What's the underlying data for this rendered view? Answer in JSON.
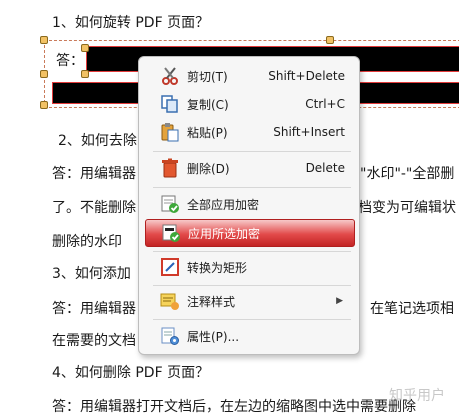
{
  "document": {
    "heading1": "1、如何旋转 PDF 页面？",
    "answer_label": "答：",
    "heading2": "2、如何去除",
    "line_a": "答：用编辑器",
    "line_a_right": "\"水印\"-\"全部删",
    "line_b": "了。不能删除",
    "line_b_right": "档变为可编辑状",
    "line_c": "删除的水印",
    "heading3": "3、如何添加",
    "line_d": "答：用编辑器",
    "line_d_right": "在笔记选项相",
    "line_e": "在需要的文档",
    "heading4": "4、如何删除 PDF 页面？",
    "line_f": "答：用编辑器打开文档后，在左边的缩略图中选中需要删除"
  },
  "context_menu": {
    "items": [
      {
        "label": "剪切(T)",
        "shortcut": "Shift+Delete",
        "icon": "scissors-icon"
      },
      {
        "label": "复制(C)",
        "shortcut": "Ctrl+C",
        "icon": "copy-icon"
      },
      {
        "label": "粘贴(P)",
        "shortcut": "Shift+Insert",
        "icon": "paste-icon"
      },
      {
        "label": "删除(D)",
        "shortcut": "Delete",
        "icon": "trash-icon"
      },
      {
        "label": "全部应用加密",
        "shortcut": "",
        "icon": "apply-all-redaction-icon"
      },
      {
        "label": "应用所选加密",
        "shortcut": "",
        "icon": "apply-selected-redaction-icon"
      },
      {
        "label": "转换为矩形",
        "shortcut": "",
        "icon": "convert-rectangle-icon"
      },
      {
        "label": "注释样式",
        "shortcut": "",
        "icon": "annotation-style-icon"
      },
      {
        "label": "属性(P)...",
        "shortcut": "",
        "icon": "properties-icon"
      }
    ]
  },
  "watermark": "知乎用户",
  "colors": {
    "highlight": "#e24a4a",
    "redaction_border": "#e23b3b",
    "handle": "#f2c265"
  }
}
